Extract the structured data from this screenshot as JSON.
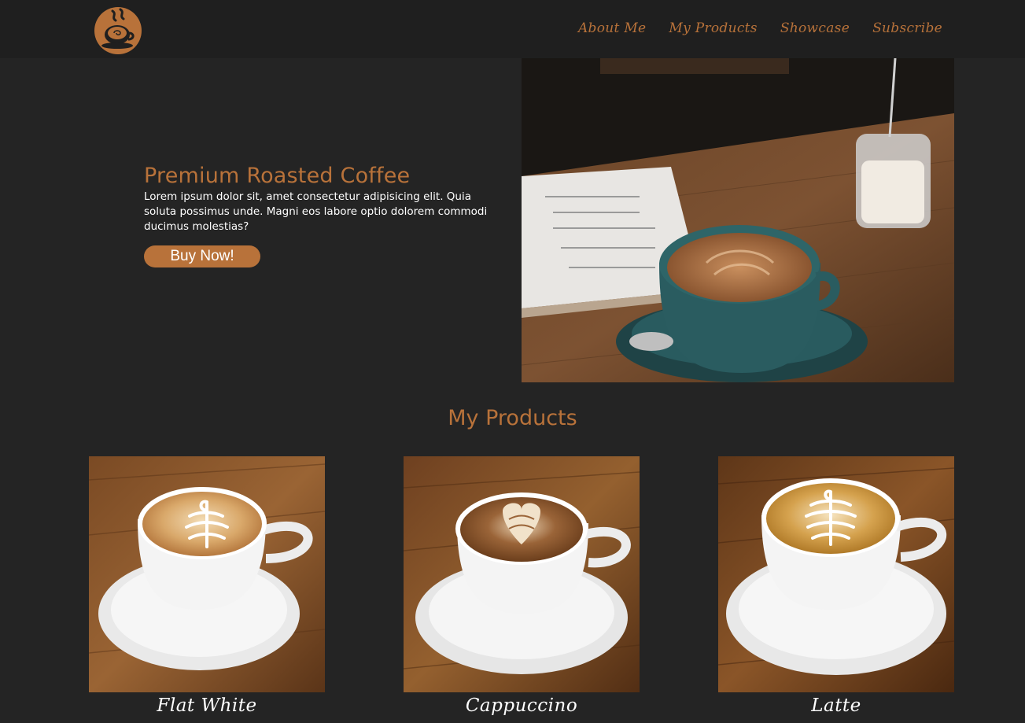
{
  "nav": {
    "logo_icon": "coffee-cup-logo-icon",
    "links": [
      "About Me",
      "My Products",
      "Showcase",
      "Subscribe"
    ]
  },
  "hero": {
    "title": "Premium Roasted Coffee",
    "description": "Lorem ipsum dolor sit, amet consectetur adipisicing elit. Quia soluta possimus unde. Magni eos labore optio dolorem commodi ducimus molestias?",
    "button_label": "Buy Now!",
    "image": "coffee-cup-on-wooden-table-photo"
  },
  "products": {
    "title": "My Products",
    "items": [
      {
        "name": "Flat White"
      },
      {
        "name": "Cappuccino"
      },
      {
        "name": "Latte"
      }
    ]
  },
  "colors": {
    "accent": "#b8723a",
    "background": "#242424",
    "navbar": "#1f1f1f",
    "text": "#ffffff"
  }
}
